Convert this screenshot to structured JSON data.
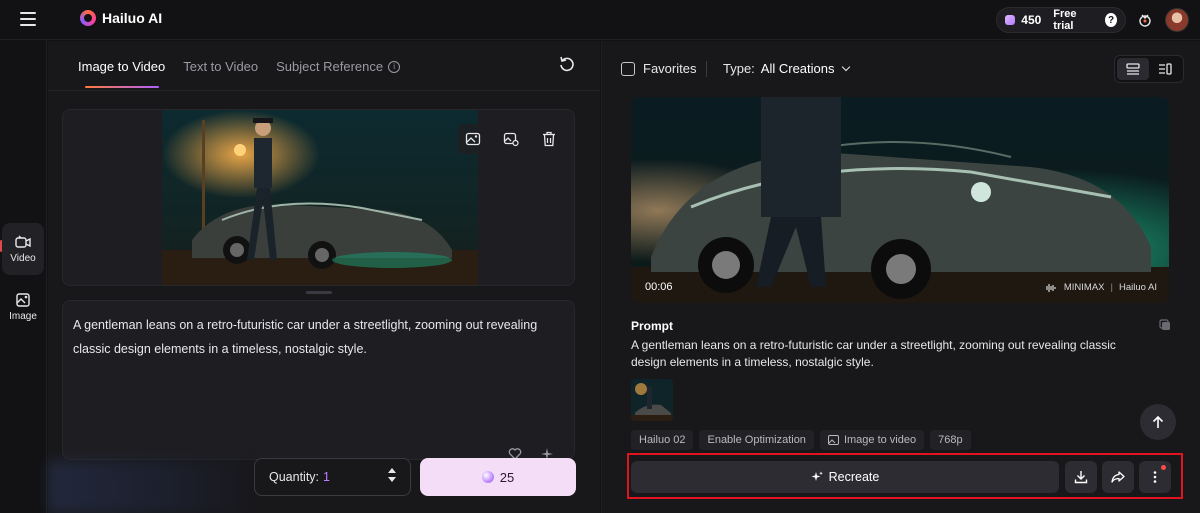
{
  "header": {
    "logo_text": "Hailuo AI",
    "credits": "450",
    "free_trial_label": "Free trial",
    "help_glyph": "?"
  },
  "rail": {
    "items": [
      {
        "label": "Video",
        "icon": "video-icon",
        "active": true
      },
      {
        "label": "Image",
        "icon": "image-icon",
        "active": false
      }
    ]
  },
  "create": {
    "tabs": [
      {
        "label": "Image to Video",
        "active": true
      },
      {
        "label": "Text to Video",
        "active": false
      },
      {
        "label": "Subject Reference",
        "active": false
      }
    ],
    "info_glyph": "i",
    "prompt": "A gentleman leans on a retro-futuristic car under a streetlight, zooming out revealing classic design elements in a timeless, nostalgic style.",
    "quantity_label": "Quantity:",
    "quantity_value": "1",
    "generate_cost": "25"
  },
  "gallery": {
    "favorites_label": "Favorites",
    "type_label": "Type:",
    "type_value": "All Creations",
    "video_duration": "00:06",
    "watermark_left": "MINIMAX",
    "watermark_right": "Hailuo AI",
    "prompt_title": "Prompt",
    "prompt_text": "A gentleman leans on a retro-futuristic car under a streetlight, zooming out revealing classic design elements in a timeless, nostalgic style.",
    "chips": [
      "Hailuo 02",
      "Enable Optimization",
      "Image to video",
      "768p"
    ],
    "recreate_label": "Recreate"
  },
  "colors": {
    "accent_pink": "#f3ddf7",
    "accent_purple": "#c27aff",
    "highlight_red": "#e0141e"
  }
}
